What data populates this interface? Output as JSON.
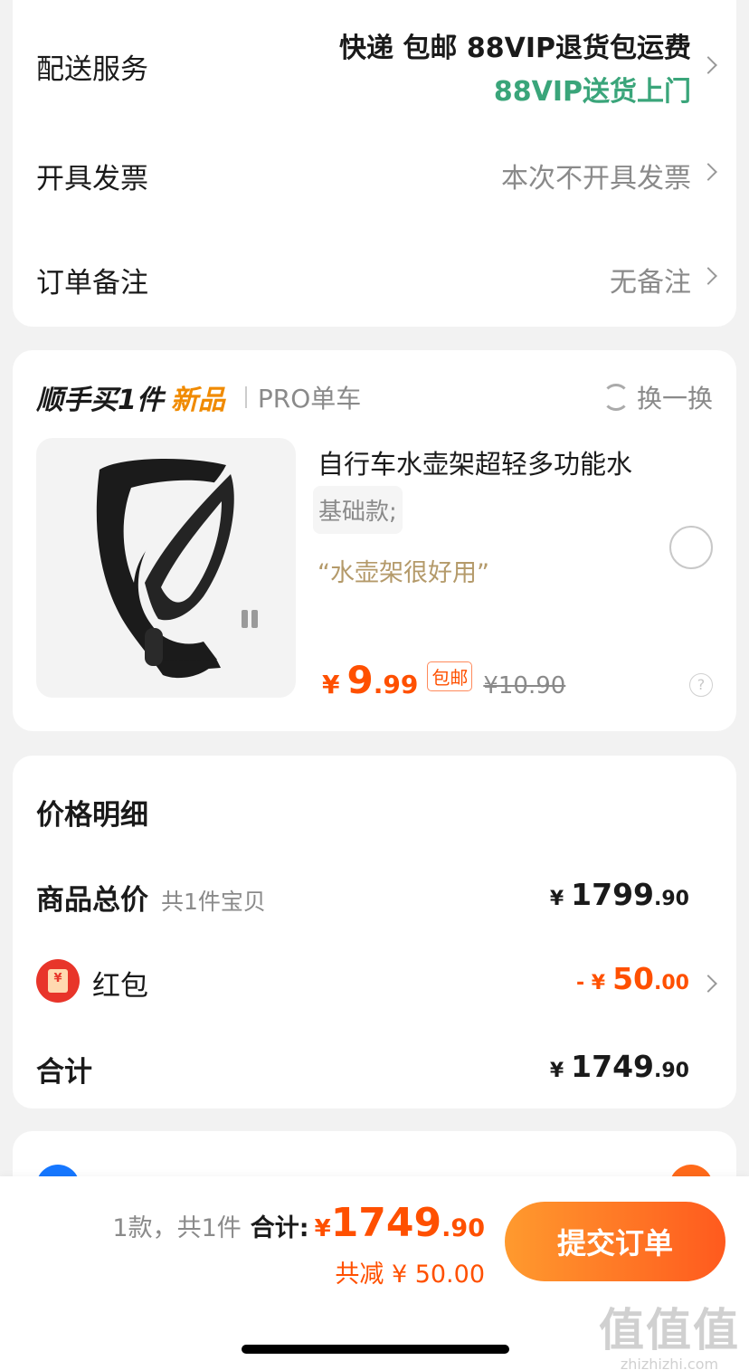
{
  "service": {
    "delivery": {
      "label": "配送服务",
      "value": "快递 包邮 88VIP退货包运费",
      "note": "88VIP送货上门"
    },
    "invoice": {
      "label": "开具发票",
      "value": "本次不开具发票"
    },
    "remark": {
      "label": "订单备注",
      "value": "无备注"
    }
  },
  "addon": {
    "title": "顺手买1件",
    "tag": "新品",
    "category": "PRO单车",
    "swap_label": "换一换",
    "product": {
      "name": "自行车水壶架超轻多功能水",
      "variant": "基础款;",
      "quote": "“水壶架很好用”",
      "price_currency": "¥",
      "price_int": "9",
      "price_dec": ".99",
      "shipping_badge": "包邮",
      "original_price": "¥10.90",
      "help_glyph": "?"
    }
  },
  "price_detail": {
    "title": "价格明细",
    "goods_total": {
      "label": "商品总价",
      "sub": "共1件宝贝",
      "currency": "¥",
      "int": "1799",
      "dec": ".90"
    },
    "red_packet": {
      "label": "红包",
      "icon_glyph": "¥",
      "prefix": "- ¥",
      "int": "50",
      "dec": ".00"
    },
    "total": {
      "label": "合计",
      "currency": "¥",
      "int": "1749",
      "dec": ".90"
    }
  },
  "bottom": {
    "count_text": "1款，共1件",
    "sum_label": "合计:",
    "currency": "¥",
    "sum_int": "1749",
    "sum_dec": ".90",
    "discount_text": "共减 ¥ 50.00",
    "submit_label": "提交订单"
  },
  "watermark": {
    "glyphs": "值值值",
    "url": "zhizhizhi.com"
  },
  "colors": {
    "accent_orange": "#ff5000",
    "vip_green": "#3aa57a",
    "button_gradient_start": "#ff9a2e",
    "button_gradient_end": "#ff5a1e"
  },
  "icons": [
    "chevron-right-icon",
    "refresh-icon",
    "radio-circle-icon",
    "help-icon",
    "red-packet-icon",
    "alipay-icon"
  ]
}
